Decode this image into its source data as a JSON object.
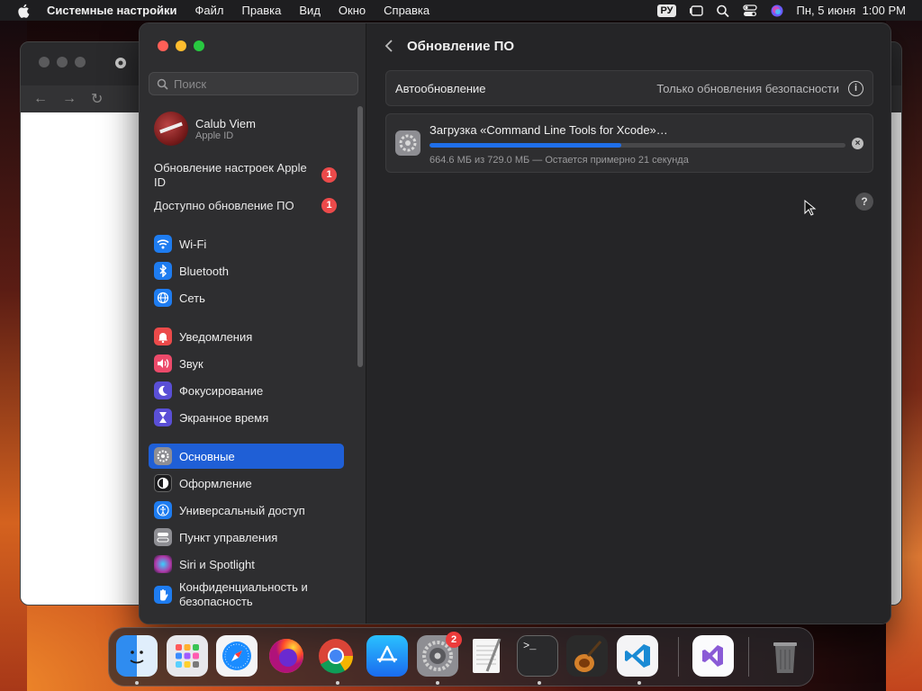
{
  "menubar": {
    "app_name": "Системные настройки",
    "items": [
      "Файл",
      "Правка",
      "Вид",
      "Окно",
      "Справка"
    ],
    "input_source": "РУ",
    "date_time": "Пн, 5 июня  1:00 PM"
  },
  "sidebar": {
    "search_placeholder": "Поиск",
    "account": {
      "name": "Calub Viem",
      "subtitle": "Apple ID"
    },
    "alerts": [
      {
        "label": "Обновление настроек Apple ID",
        "badge": "1"
      },
      {
        "label": "Доступно обновление ПО",
        "badge": "1"
      }
    ],
    "items": [
      {
        "label": "Wi-Fi",
        "icon": "wifi-icon",
        "color": "#1e7cf0"
      },
      {
        "label": "Bluetooth",
        "icon": "bluetooth-icon",
        "color": "#1e7cf0"
      },
      {
        "label": "Сеть",
        "icon": "globe-icon",
        "color": "#1e7cf0"
      },
      {
        "label": "Уведомления",
        "icon": "bell-icon",
        "color": "#ec4a4a"
      },
      {
        "label": "Звук",
        "icon": "speaker-icon",
        "color": "#ec4a6a"
      },
      {
        "label": "Фокусирование",
        "icon": "moon-icon",
        "color": "#5a4fd6"
      },
      {
        "label": "Экранное время",
        "icon": "hourglass-icon",
        "color": "#5a4fd6"
      },
      {
        "label": "Основные",
        "icon": "gear-icon",
        "color": "#8e8e93",
        "active": true
      },
      {
        "label": "Оформление",
        "icon": "appearance-icon",
        "color": "#1c1c1e"
      },
      {
        "label": "Универсальный доступ",
        "icon": "accessibility-icon",
        "color": "#1e7cf0"
      },
      {
        "label": "Пункт управления",
        "icon": "control-center-icon",
        "color": "#8e8e93"
      },
      {
        "label": "Siri и Spotlight",
        "icon": "siri-icon",
        "color": "#b03aa8"
      },
      {
        "label": "Конфиденциальность и безопасность",
        "icon": "hand-icon",
        "color": "#1e7cf0"
      }
    ]
  },
  "main": {
    "title": "Обновление ПО",
    "auto_update": {
      "label": "Автообновление",
      "value": "Только обновления безопасности"
    },
    "download": {
      "title": "Загрузка «Command Line Tools for Xcode»…",
      "status": "664.6 МБ из 729.0 МБ — Остается примерно 21 секунда",
      "progress_fraction": 0.46
    },
    "help_label": "?"
  },
  "dock": {
    "apps": [
      "finder-icon",
      "launchpad-icon",
      "safari-icon",
      "firefox-icon",
      "chrome-icon",
      "app-store-icon",
      "system-settings-icon",
      "textedit-icon",
      "terminal-icon",
      "garageband-icon",
      "vscode-icon",
      "visual-studio-icon",
      "trash-icon"
    ],
    "settings_badge": "2"
  }
}
